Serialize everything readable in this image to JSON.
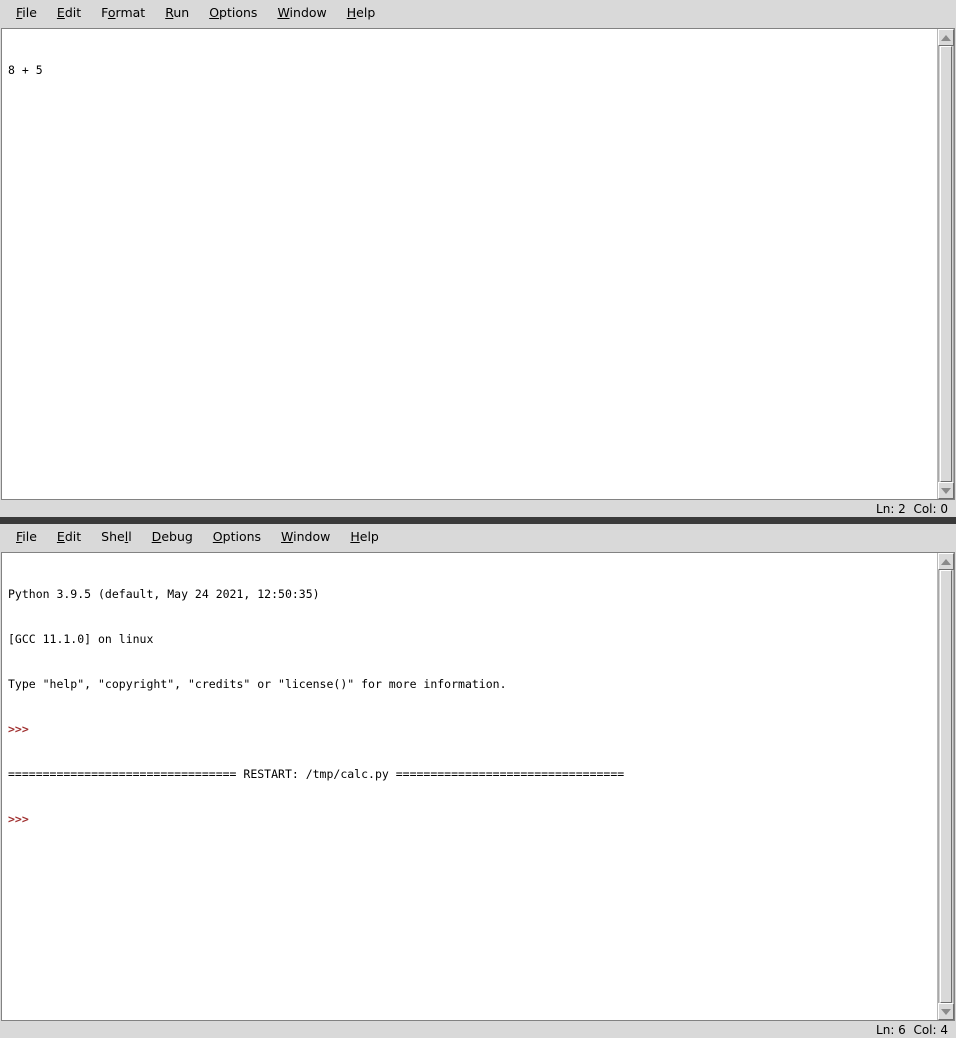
{
  "editor": {
    "menu": [
      {
        "pre": "",
        "accel": "F",
        "post": "ile",
        "name": "file"
      },
      {
        "pre": "",
        "accel": "E",
        "post": "dit",
        "name": "edit"
      },
      {
        "pre": "F",
        "accel": "o",
        "post": "rmat",
        "name": "format"
      },
      {
        "pre": "",
        "accel": "R",
        "post": "un",
        "name": "run"
      },
      {
        "pre": "",
        "accel": "O",
        "post": "ptions",
        "name": "options"
      },
      {
        "pre": "",
        "accel": "W",
        "post": "indow",
        "name": "window"
      },
      {
        "pre": "",
        "accel": "H",
        "post": "elp",
        "name": "help"
      }
    ],
    "lines": [
      "8 + 5"
    ],
    "status": "Ln: 2  Col: 0"
  },
  "shell": {
    "menu": [
      {
        "pre": "",
        "accel": "F",
        "post": "ile",
        "name": "file"
      },
      {
        "pre": "",
        "accel": "E",
        "post": "dit",
        "name": "edit"
      },
      {
        "pre": "She",
        "accel": "l",
        "post": "l",
        "name": "shell"
      },
      {
        "pre": "",
        "accel": "D",
        "post": "ebug",
        "name": "debug"
      },
      {
        "pre": "",
        "accel": "O",
        "post": "ptions",
        "name": "options"
      },
      {
        "pre": "",
        "accel": "W",
        "post": "indow",
        "name": "window"
      },
      {
        "pre": "",
        "accel": "H",
        "post": "elp",
        "name": "help"
      }
    ],
    "lines": {
      "l1": "Python 3.9.5 (default, May 24 2021, 12:50:35)",
      "l2": "[GCC 11.1.0] on linux",
      "l3": "Type \"help\", \"copyright\", \"credits\" or \"license()\" for more information.",
      "prompt1": ">>> ",
      "restart": "================================= RESTART: /tmp/calc.py =================================",
      "prompt2": ">>> "
    },
    "status": "Ln: 6  Col: 4"
  },
  "colors": {
    "chrome": "#d9d9d9",
    "text_bg": "#ffffff",
    "prompt": "#a03030",
    "divider": "#3a3a3a"
  },
  "icons": {
    "scroll_up": "scroll-up-arrow-icon",
    "scroll_down": "scroll-down-arrow-icon"
  }
}
